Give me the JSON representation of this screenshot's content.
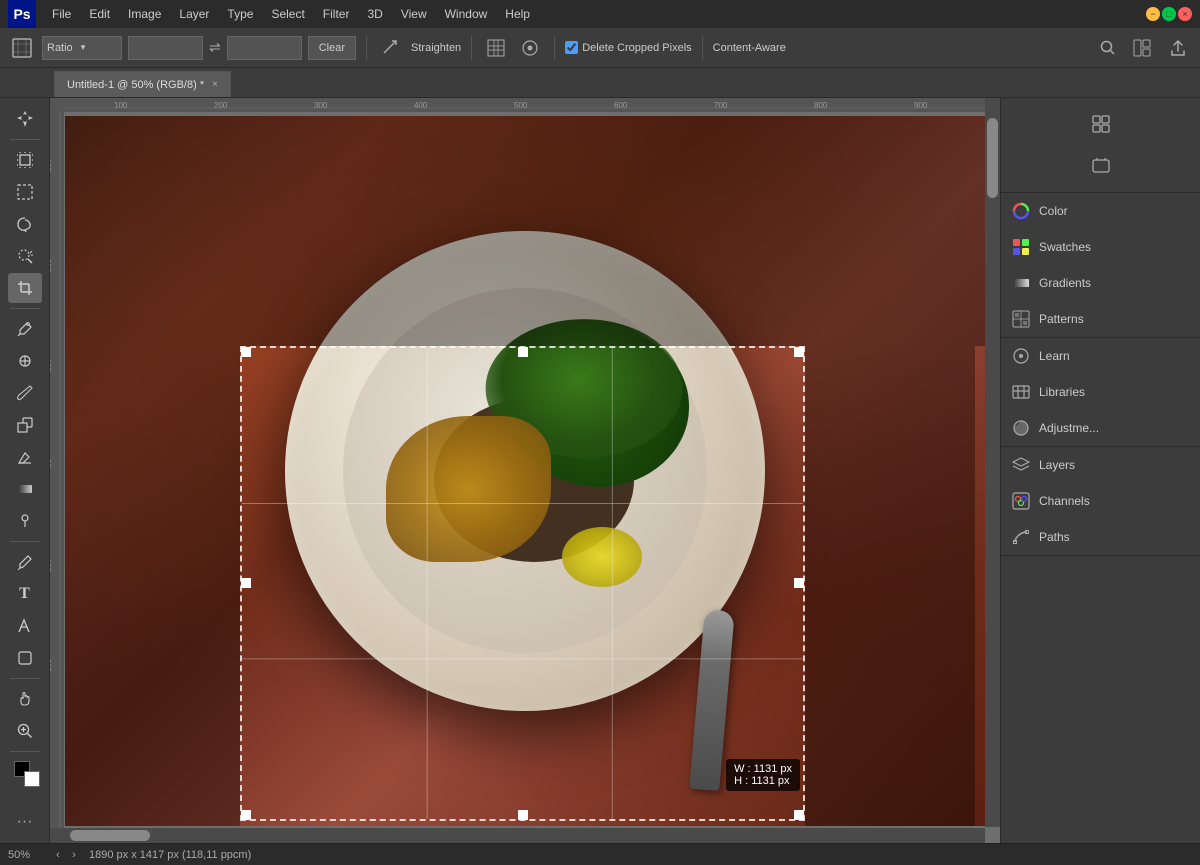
{
  "app": {
    "name": "Adobe Photoshop",
    "logo": "Ps"
  },
  "menu": {
    "items": [
      "File",
      "Edit",
      "Image",
      "Layer",
      "Type",
      "Select",
      "Filter",
      "3D",
      "View",
      "Window",
      "Help"
    ]
  },
  "window_controls": {
    "minimize": "−",
    "maximize": "□",
    "close": "×"
  },
  "options_bar": {
    "tool_icon": "⬜",
    "ratio_label": "Ratio",
    "ratio_dropdown_arrow": "▾",
    "width_placeholder": "",
    "swap_icon": "⇌",
    "height_placeholder": "",
    "clear_btn": "Clear",
    "straighten_icon": "⊘",
    "straighten_label": "Straighten",
    "grid_icon": "⊞",
    "gear_icon": "⚙",
    "delete_cropped": "Delete Cropped Pixels",
    "content_aware": "Content-Aware",
    "search_icon": "🔍",
    "layout_icon": "◫",
    "share_icon": "↑"
  },
  "tab": {
    "title": "Untitled-1 @ 50% (RGB/8) *",
    "close": "×"
  },
  "tools": [
    {
      "name": "move",
      "icon": "✛",
      "title": "Move Tool"
    },
    {
      "name": "artboard",
      "icon": "⬛",
      "title": "Artboard Tool"
    },
    {
      "name": "marquee-rect",
      "icon": "⬜",
      "title": "Rectangular Marquee"
    },
    {
      "name": "marquee-lasso",
      "icon": "⊙",
      "title": "Lasso Tool"
    },
    {
      "name": "magic-wand",
      "icon": "⊛",
      "title": "Quick Selection"
    },
    {
      "name": "crop",
      "icon": "⊡",
      "title": "Crop Tool",
      "active": true
    },
    {
      "name": "eyedropper",
      "icon": "⊘",
      "title": "Eyedropper"
    },
    {
      "name": "healing",
      "icon": "⊕",
      "title": "Healing Brush"
    },
    {
      "name": "brush",
      "icon": "✏",
      "title": "Brush Tool"
    },
    {
      "name": "clone",
      "icon": "⊚",
      "title": "Clone Stamp"
    },
    {
      "name": "eraser",
      "icon": "◻",
      "title": "Eraser"
    },
    {
      "name": "gradient",
      "icon": "◼",
      "title": "Gradient Tool"
    },
    {
      "name": "dodge",
      "icon": "○",
      "title": "Dodge Tool"
    },
    {
      "name": "pen",
      "icon": "⊳",
      "title": "Pen Tool"
    },
    {
      "name": "text",
      "icon": "T",
      "title": "Text Tool"
    },
    {
      "name": "path-select",
      "icon": "↗",
      "title": "Path Selection"
    },
    {
      "name": "shape",
      "icon": "◻",
      "title": "Shape Tool"
    },
    {
      "name": "hand",
      "icon": "✋",
      "title": "Hand Tool"
    },
    {
      "name": "zoom",
      "icon": "⊕",
      "title": "Zoom Tool"
    },
    {
      "name": "more-tools",
      "icon": "…",
      "title": "More Tools"
    }
  ],
  "right_panel": {
    "sections": [
      {
        "items": [
          {
            "icon": "🎨",
            "label": "Color",
            "icon_name": "color-icon"
          },
          {
            "icon": "⊞",
            "label": "Swatches",
            "icon_name": "swatches-icon"
          },
          {
            "icon": "◈",
            "label": "Gradients",
            "icon_name": "gradients-icon"
          },
          {
            "icon": "⊟",
            "label": "Patterns",
            "icon_name": "patterns-icon"
          }
        ]
      },
      {
        "separator": true,
        "items": [
          {
            "icon": "💡",
            "label": "Learn",
            "icon_name": "learn-icon"
          },
          {
            "icon": "📚",
            "label": "Libraries",
            "icon_name": "libraries-icon"
          },
          {
            "icon": "◎",
            "label": "Adjustme...",
            "icon_name": "adjustments-icon"
          }
        ]
      },
      {
        "separator": true,
        "items": [
          {
            "icon": "⊞",
            "label": "Layers",
            "icon_name": "layers-icon"
          },
          {
            "icon": "⊙",
            "label": "Channels",
            "icon_name": "channels-icon"
          },
          {
            "icon": "⊡",
            "label": "Paths",
            "icon_name": "paths-icon"
          }
        ]
      }
    ]
  },
  "crop_info": {
    "width_label": "W : 1131 px",
    "height_label": "H : 1131 px"
  },
  "status_bar": {
    "zoom": "50%",
    "dimensions": "1890 px x 1417 px (118,11 ppcm)",
    "nav_prev": "‹",
    "nav_next": "›"
  }
}
